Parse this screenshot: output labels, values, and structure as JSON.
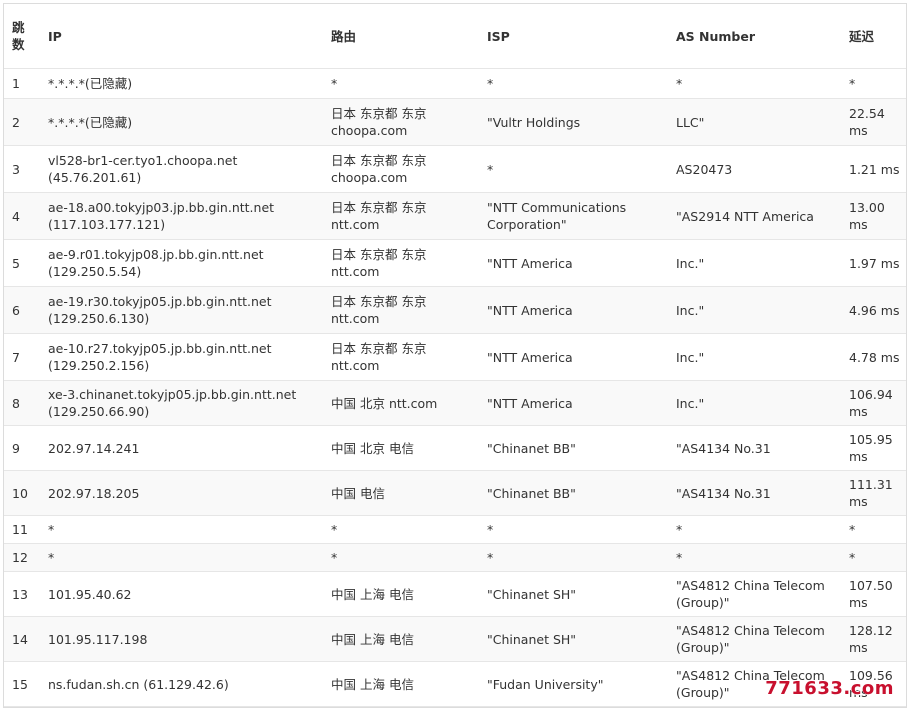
{
  "headers": {
    "hop": "跳数",
    "ip": "IP",
    "route": "路由",
    "isp": "ISP",
    "as_number": "AS Number",
    "latency": "延迟"
  },
  "rows": [
    {
      "hop": "1",
      "ip": "*.*.*.*(已隐藏)",
      "route": "*",
      "isp": "*",
      "as_number": "*",
      "latency": "*"
    },
    {
      "hop": "2",
      "ip": "*.*.*.*(已隐藏)",
      "route": "日本 东京都 东京 choopa.com",
      "isp": "\"Vultr Holdings",
      "as_number": "LLC\"",
      "latency": "22.54 ms"
    },
    {
      "hop": "3",
      "ip": "vl528-br1-cer.tyo1.choopa.net (45.76.201.61)",
      "route": "日本 东京都 东京 choopa.com",
      "isp": "*",
      "as_number": "AS20473",
      "latency": "1.21 ms"
    },
    {
      "hop": "4",
      "ip": "ae-18.a00.tokyjp03.jp.bb.gin.ntt.net (117.103.177.121)",
      "route": "日本 东京都 东京 ntt.com",
      "isp": "\"NTT Communications Corporation\"",
      "as_number": "\"AS2914 NTT America",
      "latency": "13.00 ms"
    },
    {
      "hop": "5",
      "ip": "ae-9.r01.tokyjp08.jp.bb.gin.ntt.net (129.250.5.54)",
      "route": "日本 东京都 东京 ntt.com",
      "isp": "\"NTT America",
      "as_number": "Inc.\"",
      "latency": "1.97 ms"
    },
    {
      "hop": "6",
      "ip": "ae-19.r30.tokyjp05.jp.bb.gin.ntt.net (129.250.6.130)",
      "route": "日本 东京都 东京 ntt.com",
      "isp": "\"NTT America",
      "as_number": "Inc.\"",
      "latency": "4.96 ms"
    },
    {
      "hop": "7",
      "ip": "ae-10.r27.tokyjp05.jp.bb.gin.ntt.net (129.250.2.156)",
      "route": "日本 东京都 东京 ntt.com",
      "isp": "\"NTT America",
      "as_number": "Inc.\"",
      "latency": "4.78 ms"
    },
    {
      "hop": "8",
      "ip": "xe-3.chinanet.tokyjp05.jp.bb.gin.ntt.net (129.250.66.90)",
      "route": "中国 北京 ntt.com",
      "isp": "\"NTT America",
      "as_number": "Inc.\"",
      "latency": "106.94 ms"
    },
    {
      "hop": "9",
      "ip": "202.97.14.241",
      "route": "中国 北京 电信",
      "isp": "\"Chinanet BB\"",
      "as_number": "\"AS4134 No.31",
      "latency": "105.95 ms"
    },
    {
      "hop": "10",
      "ip": "202.97.18.205",
      "route": "中国 电信",
      "isp": "\"Chinanet BB\"",
      "as_number": "\"AS4134 No.31",
      "latency": "111.31 ms"
    },
    {
      "hop": "11",
      "ip": "*",
      "route": "*",
      "isp": "*",
      "as_number": "*",
      "latency": "*"
    },
    {
      "hop": "12",
      "ip": "*",
      "route": "*",
      "isp": "*",
      "as_number": "*",
      "latency": "*"
    },
    {
      "hop": "13",
      "ip": "101.95.40.62",
      "route": "中国 上海 电信",
      "isp": "\"Chinanet SH\"",
      "as_number": "\"AS4812 China Telecom (Group)\"",
      "latency": "107.50 ms"
    },
    {
      "hop": "14",
      "ip": "101.95.117.198",
      "route": "中国 上海 电信",
      "isp": "\"Chinanet SH\"",
      "as_number": "\"AS4812 China Telecom (Group)\"",
      "latency": "128.12 ms"
    },
    {
      "hop": "15",
      "ip": "ns.fudan.sh.cn (61.129.42.6)",
      "route": "中国 上海 电信",
      "isp": "\"Fudan University\"",
      "as_number": "\"AS4812 China Telecom (Group)\"",
      "latency": "109.56 ms"
    }
  ],
  "watermark": "771633.com",
  "colors": {
    "header_bg": "#ffffff",
    "stripe_bg": "#f9f9f9",
    "border": "#e6e6e6",
    "text": "#333333",
    "watermark": "#c8102e"
  }
}
